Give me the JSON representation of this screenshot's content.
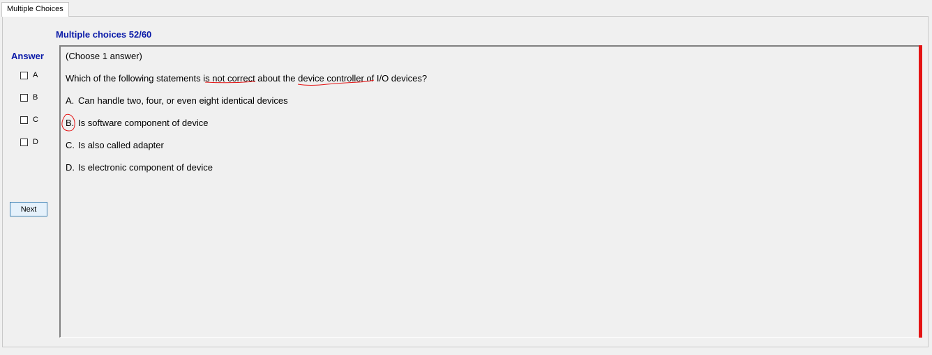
{
  "tab": {
    "label": "Multiple Choices"
  },
  "header": {
    "title": "Multiple choices 52/60"
  },
  "answer_panel": {
    "label": "Answer",
    "choices": [
      {
        "label": "A",
        "checked": false
      },
      {
        "label": "B",
        "checked": false
      },
      {
        "label": "C",
        "checked": false
      },
      {
        "label": "D",
        "checked": false
      }
    ],
    "next_label": "Next"
  },
  "question": {
    "instruction": "(Choose 1 answer)",
    "stem_parts": [
      "Which of the following statements is ",
      "not correct",
      " about the ",
      "device controller",
      " of I/O devices?"
    ],
    "options": [
      {
        "letter": "A.",
        "text": "Can handle two, four, or even eight identical devices"
      },
      {
        "letter": "B.",
        "text": "Is software component of device"
      },
      {
        "letter": "C.",
        "text": "Is also called adapter"
      },
      {
        "letter": "D.",
        "text": "Is electronic component of device"
      }
    ]
  },
  "colors": {
    "title_blue": "#0a1aa8",
    "annotation_red": "#e41414",
    "button_border": "#3c7fb1"
  }
}
